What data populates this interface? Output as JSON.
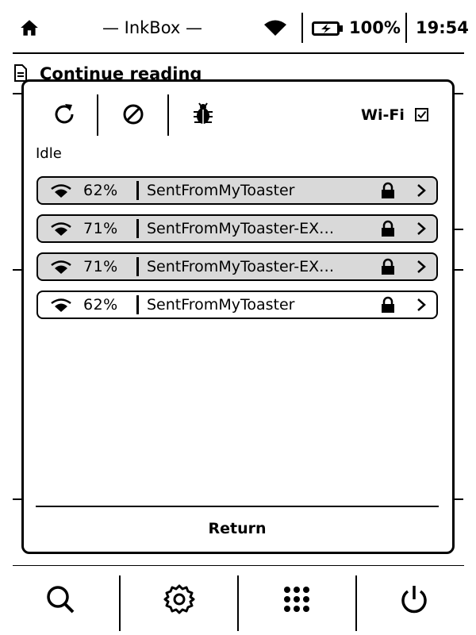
{
  "status_bar": {
    "title": "— InkBox —",
    "battery": "100%",
    "time": "19:54",
    "icons": [
      "home-icon",
      "wifi-icon",
      "battery-charging-icon"
    ]
  },
  "background": {
    "section_title": "Continue reading",
    "icons": [
      "document-icon"
    ]
  },
  "wifi_dialog": {
    "toolbar_icons": [
      "refresh-icon",
      "disable-icon",
      "bug-icon"
    ],
    "wifi_label": "Wi-Fi",
    "wifi_enabled": true,
    "status": "Idle",
    "networks": [
      {
        "signal": "62%",
        "ssid": "SentFromMyToaster",
        "secured": true,
        "selected": true
      },
      {
        "signal": "71%",
        "ssid": "SentFromMyToaster-EX…",
        "secured": true,
        "selected": true
      },
      {
        "signal": "71%",
        "ssid": "SentFromMyToaster-EX…",
        "secured": true,
        "selected": true
      },
      {
        "signal": "62%",
        "ssid": "SentFromMyToaster",
        "secured": true,
        "selected": false
      }
    ],
    "return_label": "Return"
  },
  "bottom_toolbar": {
    "icons": [
      "search-icon",
      "settings-icon",
      "apps-grid-icon",
      "power-icon"
    ]
  }
}
